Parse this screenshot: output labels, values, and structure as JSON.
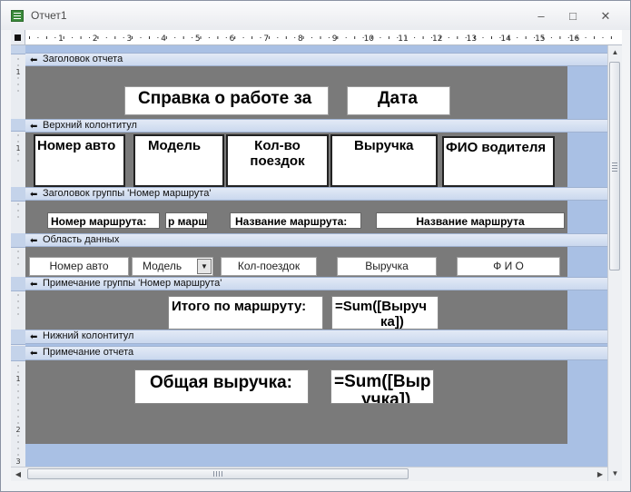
{
  "window": {
    "title": "Отчет1",
    "minimize": "–",
    "maximize": "□",
    "close": "✕"
  },
  "ruler": {
    "marks": [
      "1",
      "2",
      "3",
      "4",
      "5",
      "6",
      "7",
      "8",
      "9",
      "10",
      "11",
      "12",
      "13",
      "14",
      "15",
      "16"
    ]
  },
  "sections": {
    "report_header": "Заголовок отчета",
    "page_header": "Верхний колонтитул",
    "group_header": "Заголовок группы 'Номер маршрута'",
    "detail": "Область данных",
    "group_footer": "Примечание группы 'Номер маршрута'",
    "page_footer": "Нижний колонтитул",
    "report_footer": "Примечание отчета"
  },
  "report_header": {
    "title": "Справка о работе за",
    "date": "Дата"
  },
  "page_header": {
    "car_number": "Номер авто",
    "model": "Модель",
    "trips_line1": "Кол-во",
    "trips_line2": "поездок",
    "revenue": "Выручка",
    "driver": "ФИО водителя"
  },
  "group_header": {
    "route_number_label": "Номер маршрута:",
    "route_number_field": "р марш",
    "route_name_label": "Название маршрута:",
    "route_name_field": "Название маршрута"
  },
  "detail": {
    "car_number": "Номер авто",
    "model": "Модель",
    "trips": "Кол-поездок",
    "revenue": "Выручка",
    "fio": "Ф И О"
  },
  "group_footer": {
    "total_label": "Итого по маршруту:",
    "sum_line1": "=Sum([Выруч",
    "sum_line2": "ка])"
  },
  "report_footer": {
    "total_label": "Общая выручка:",
    "sum_line1": "=Sum([Выр",
    "sum_line2": "учка])"
  },
  "icons": {
    "section_arrow": "section-arrow-icon",
    "combo_arrow": "dropdown-arrow-icon"
  },
  "colors": {
    "canvas_bg": "#a9c0e4",
    "section_bar": "#cad8ee",
    "grid": "#7a7a7a"
  }
}
